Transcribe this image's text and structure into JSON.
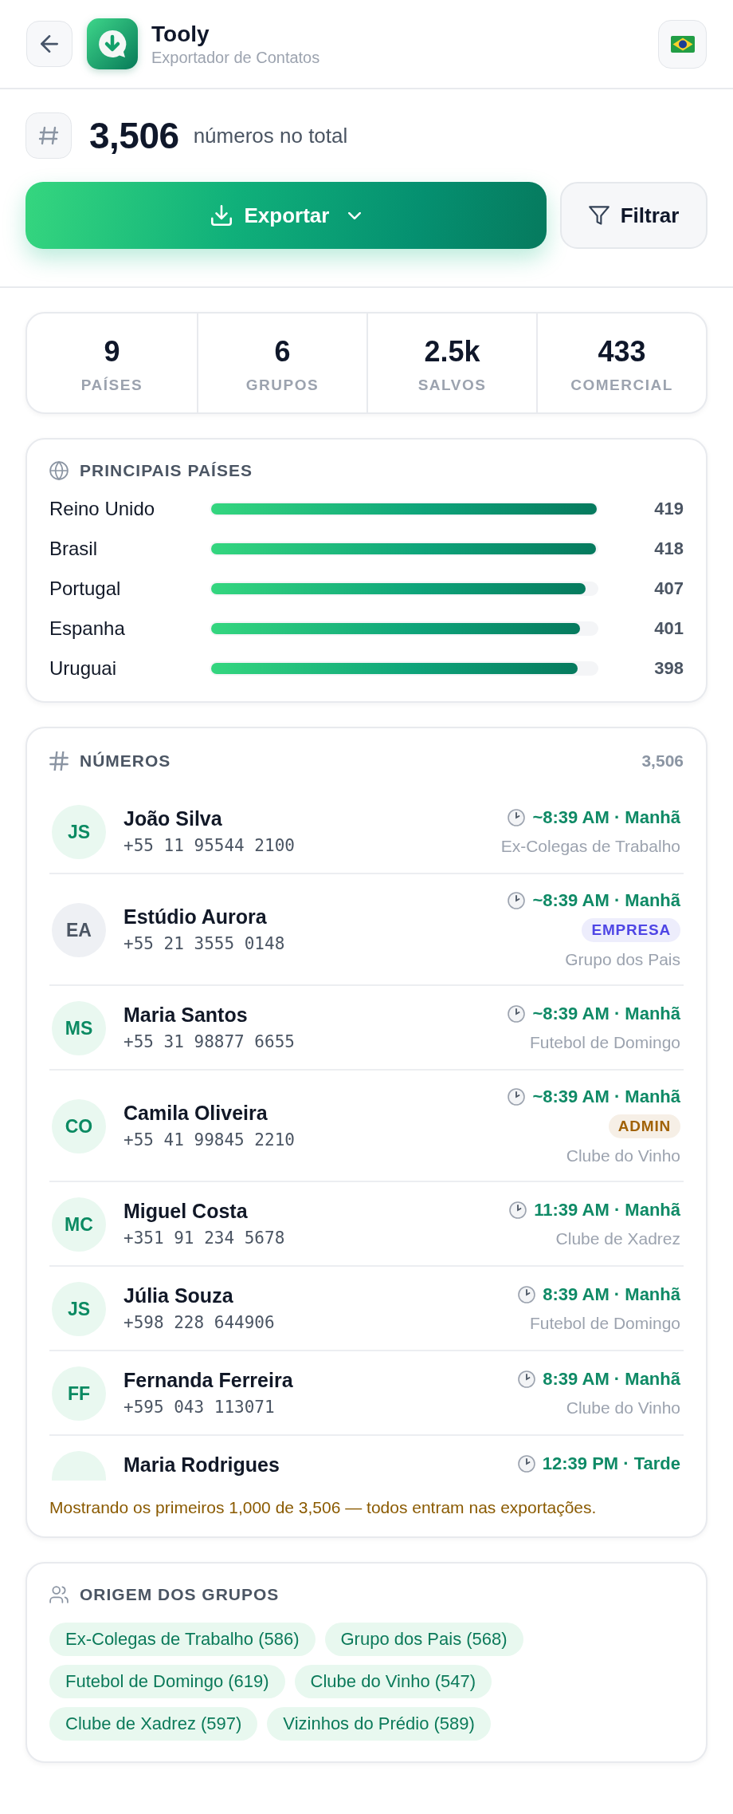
{
  "header": {
    "title": "Tooly",
    "subtitle": "Exportador de Contatos"
  },
  "summary": {
    "total": "3,506",
    "label": "números no total",
    "export_label": "Exportar",
    "filter_label": "Filtrar"
  },
  "stats": [
    {
      "value": "9",
      "label": "PAÍSES"
    },
    {
      "value": "6",
      "label": "GRUPOS"
    },
    {
      "value": "2.5k",
      "label": "SALVOS"
    },
    {
      "value": "433",
      "label": "COMERCIAL"
    }
  ],
  "countries": {
    "title": "PRINCIPAIS PAÍSES",
    "items": [
      {
        "name": "Reino Unido",
        "level": 1,
        "count": "419"
      },
      {
        "name": "Brasil",
        "level": 0.998,
        "count": "418"
      },
      {
        "name": "Portugal",
        "level": 0.971,
        "count": "407"
      },
      {
        "name": "Espanha",
        "level": 0.957,
        "count": "401"
      },
      {
        "name": "Uruguai",
        "level": 0.95,
        "count": "398"
      }
    ]
  },
  "numbers": {
    "title": "NÚMEROS",
    "count": "3,506",
    "contacts": [
      {
        "kind": "person",
        "initials": "JS",
        "name": "João Silva",
        "phone": "+55 11 95544 2100",
        "time": "~8:39 AM · Manhã",
        "group": "Ex-Colegas de Trabalho"
      },
      {
        "kind": "business",
        "initials": "EA",
        "name": "Estúdio Aurora",
        "phone": "+55 21 3555 0148",
        "time": "~8:39 AM · Manhã",
        "tag": {
          "text": "EMPRESA",
          "color": "#4f46e5"
        },
        "group": "Grupo dos Pais"
      },
      {
        "kind": "person",
        "initials": "MS",
        "name": "Maria Santos",
        "phone": "+55 31 98877 6655",
        "time": "~8:39 AM · Manhã",
        "group": "Futebol de Domingo"
      },
      {
        "kind": "person",
        "initials": "CO",
        "name": "Camila Oliveira",
        "phone": "+55 41 99845 2210",
        "time": "~8:39 AM · Manhã",
        "tag": {
          "text": "ADMIN",
          "color": "#a16207"
        },
        "group": "Clube do Vinho"
      },
      {
        "kind": "person",
        "initials": "MC",
        "name": "Miguel Costa",
        "phone": "+351 91 234 5678",
        "time": "11:39 AM · Manhã",
        "group": "Clube de Xadrez"
      },
      {
        "kind": "person",
        "initials": "JS",
        "name": "Júlia Souza",
        "phone": "+598 228 644906",
        "time": "8:39 AM · Manhã",
        "group": "Futebol de Domingo"
      },
      {
        "kind": "person",
        "initials": "FF",
        "name": "Fernanda Ferreira",
        "phone": "+595 043 113071",
        "time": "8:39 AM · Manhã",
        "group": "Clube do Vinho"
      },
      {
        "kind": "person",
        "name": "Maria Rodrigues",
        "time": "12:39 PM · Tarde"
      }
    ],
    "note": "Mostrando os primeiros 1,000 de 3,506 — todos entram nas exportações."
  },
  "groups": {
    "title": "ORIGEM DOS GRUPOS",
    "chips": [
      "Ex-Colegas de Trabalho (586)",
      "Grupo dos Pais (568)",
      "Futebol de Domingo (619)",
      "Clube do Vinho (547)",
      "Clube de Xadrez (597)",
      "Vizinhos do Prédio (589)"
    ]
  }
}
